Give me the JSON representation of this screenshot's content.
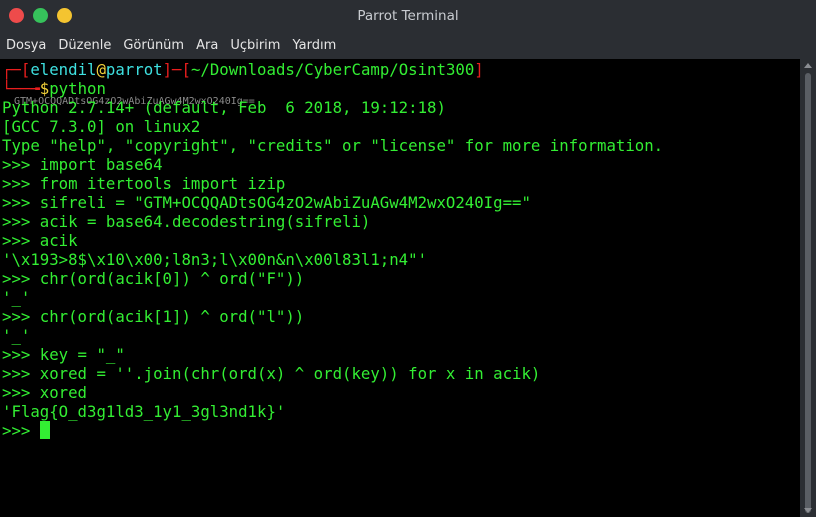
{
  "window": {
    "title": "Parrot Terminal"
  },
  "menu": [
    "Dosya",
    "Düzenle",
    "Görünüm",
    "Ara",
    "Uçbirim",
    "Yardım"
  ],
  "prompt": {
    "open": "┌─[",
    "user": "elendil",
    "at": "@",
    "host": "parrot",
    "mid": "]─[",
    "path": "~/Downloads/CyberCamp/Osint300",
    "close": "]",
    "corner": "└──╼",
    "dollar": "$",
    "command": "python",
    "ghost_text": "GTM+OCQQADtsOG4zO2wAbiZuAGw4M2wxO240Ig=="
  },
  "output": [
    "Python 2.7.14+ (default, Feb  6 2018, 19:12:18)",
    "[GCC 7.3.0] on linux2",
    "Type \"help\", \"copyright\", \"credits\" or \"license\" for more information.",
    ">>> import base64",
    ">>> from itertools import izip",
    ">>> sifreli = \"GTM+OCQQADtsOG4zO2wAbiZuAGw4M2wxO240Ig==\"",
    ">>> acik = base64.decodestring(sifreli)",
    ">>> acik",
    "'\\x193>8$\\x10\\x00;l8n3;l\\x00n&n\\x00l83l1;n4\"'",
    ">>> chr(ord(acik[0]) ^ ord(\"F\"))",
    "'_'",
    ">>> chr(ord(acik[1]) ^ ord(\"l\"))",
    "'_'",
    ">>> key = \"_\"",
    ">>> xored = ''.join(chr(ord(x) ^ ord(key)) for x in acik)",
    ">>> xored",
    "'Flag{O_d3g1ld3_1y1_3gl3nd1k}'"
  ],
  "last_prompt": ">>> "
}
